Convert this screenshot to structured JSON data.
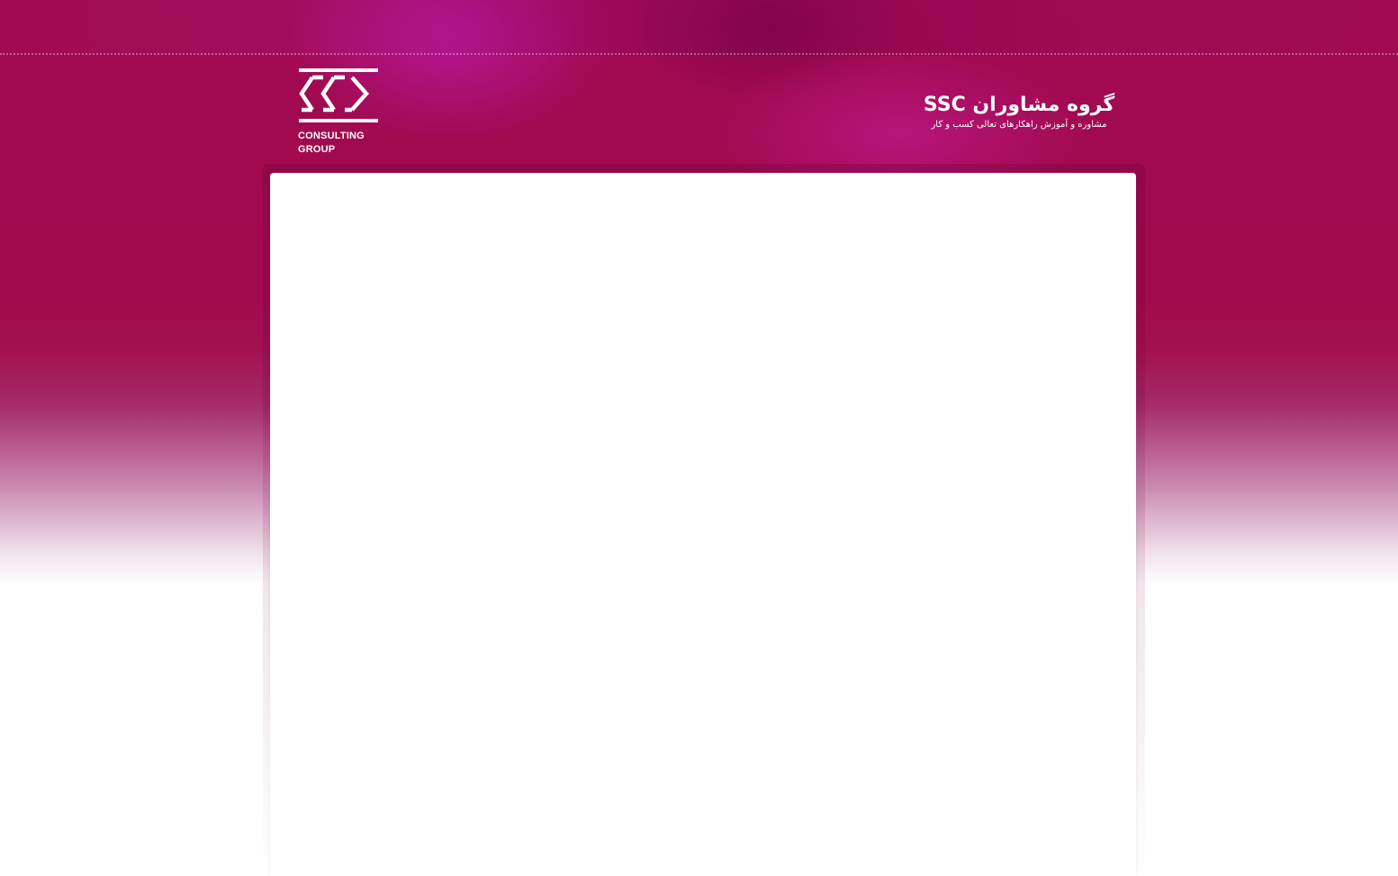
{
  "header": {
    "logo_left": {
      "icon": "ssc-chevrons-logo-icon",
      "line1": "CONSULTING",
      "line2": "GROUP"
    },
    "logo_right": {
      "title": "گروه مشاوران SSC",
      "tagline": "مشاوره و آموزش راهکارهای تعالی کسب و کار"
    }
  },
  "content": {},
  "colors": {
    "brand_magenta": "#a10a52",
    "accent_pink": "#b9199f",
    "panel_bg": "#ffffff",
    "text_on_brand": "#ffffff"
  }
}
